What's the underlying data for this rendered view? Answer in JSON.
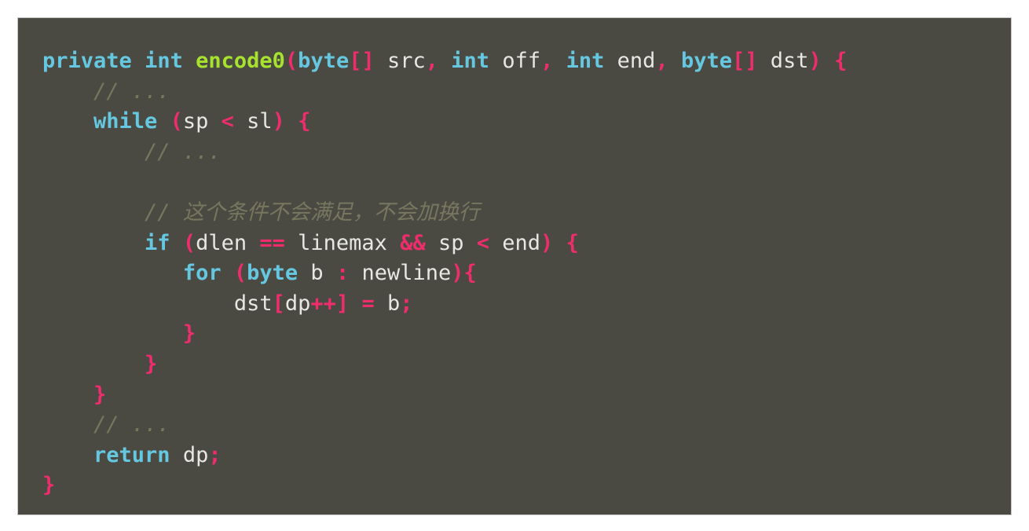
{
  "window": {
    "background_color": "#ffffff",
    "code_background_color": "#4a4a42",
    "border_color": "#c9c9c9"
  },
  "theme": {
    "name": "monokai-like",
    "keyword_color": "#66c7e0",
    "type_color": "#66c7e0",
    "method_color": "#a6e22e",
    "punctuation_color": "#ef2d6d",
    "operator_color": "#ef2d6d",
    "plain_color": "#e8e8e3",
    "comment_color": "#77775f"
  },
  "code": {
    "language": "java",
    "plain_text": "private int encode0(byte[] src, int off, int end, byte[] dst) {\n    // ...\n    while (sp < sl) {\n        // ...\n\n        // 这个条件不会满足，不会加换行\n        if (dlen == linemax && sp < end) {\n           for (byte b : newline){\n               dst[dp++] = b;\n           }\n        }\n    }\n    // ...\n    return dp;\n}",
    "lines": [
      {
        "index": 1,
        "tokens": [
          {
            "text": "private",
            "kind": "keyword"
          },
          {
            "text": " ",
            "kind": "space"
          },
          {
            "text": "int",
            "kind": "keyword"
          },
          {
            "text": " ",
            "kind": "space"
          },
          {
            "text": "encode0",
            "kind": "method"
          },
          {
            "text": "(",
            "kind": "punct"
          },
          {
            "text": "byte",
            "kind": "type"
          },
          {
            "text": "[]",
            "kind": "punct"
          },
          {
            "text": " src",
            "kind": "plain"
          },
          {
            "text": ",",
            "kind": "punct"
          },
          {
            "text": " ",
            "kind": "space"
          },
          {
            "text": "int",
            "kind": "type"
          },
          {
            "text": " off",
            "kind": "plain"
          },
          {
            "text": ",",
            "kind": "punct"
          },
          {
            "text": " ",
            "kind": "space"
          },
          {
            "text": "int",
            "kind": "type"
          },
          {
            "text": " end",
            "kind": "plain"
          },
          {
            "text": ",",
            "kind": "punct"
          },
          {
            "text": " ",
            "kind": "space"
          },
          {
            "text": "byte",
            "kind": "type"
          },
          {
            "text": "[]",
            "kind": "punct"
          },
          {
            "text": " dst",
            "kind": "plain"
          },
          {
            "text": ")",
            "kind": "punct"
          },
          {
            "text": " ",
            "kind": "space"
          },
          {
            "text": "{",
            "kind": "punct"
          }
        ]
      },
      {
        "index": 2,
        "tokens": [
          {
            "text": "    ",
            "kind": "space"
          },
          {
            "text": "// ...",
            "kind": "comment"
          }
        ]
      },
      {
        "index": 3,
        "tokens": [
          {
            "text": "    ",
            "kind": "space"
          },
          {
            "text": "while",
            "kind": "keyword"
          },
          {
            "text": " ",
            "kind": "space"
          },
          {
            "text": "(",
            "kind": "punct"
          },
          {
            "text": "sp ",
            "kind": "plain"
          },
          {
            "text": "<",
            "kind": "operator"
          },
          {
            "text": " sl",
            "kind": "plain"
          },
          {
            "text": ")",
            "kind": "punct"
          },
          {
            "text": " ",
            "kind": "space"
          },
          {
            "text": "{",
            "kind": "punct"
          }
        ]
      },
      {
        "index": 4,
        "tokens": [
          {
            "text": "        ",
            "kind": "space"
          },
          {
            "text": "// ...",
            "kind": "comment"
          }
        ]
      },
      {
        "index": 5,
        "tokens": [
          {
            "text": "",
            "kind": "space"
          }
        ]
      },
      {
        "index": 6,
        "tokens": [
          {
            "text": "        ",
            "kind": "space"
          },
          {
            "text": "// 这个条件不会满足，不会加换行",
            "kind": "comment"
          }
        ]
      },
      {
        "index": 7,
        "tokens": [
          {
            "text": "        ",
            "kind": "space"
          },
          {
            "text": "if",
            "kind": "keyword"
          },
          {
            "text": " ",
            "kind": "space"
          },
          {
            "text": "(",
            "kind": "punct"
          },
          {
            "text": "dlen ",
            "kind": "plain"
          },
          {
            "text": "==",
            "kind": "operator"
          },
          {
            "text": " linemax ",
            "kind": "plain"
          },
          {
            "text": "&&",
            "kind": "operator"
          },
          {
            "text": " sp ",
            "kind": "plain"
          },
          {
            "text": "<",
            "kind": "operator"
          },
          {
            "text": " end",
            "kind": "plain"
          },
          {
            "text": ")",
            "kind": "punct"
          },
          {
            "text": " ",
            "kind": "space"
          },
          {
            "text": "{",
            "kind": "punct"
          }
        ]
      },
      {
        "index": 8,
        "tokens": [
          {
            "text": "           ",
            "kind": "space"
          },
          {
            "text": "for",
            "kind": "keyword"
          },
          {
            "text": " ",
            "kind": "space"
          },
          {
            "text": "(",
            "kind": "punct"
          },
          {
            "text": "byte",
            "kind": "type"
          },
          {
            "text": " b ",
            "kind": "plain"
          },
          {
            "text": ":",
            "kind": "punct"
          },
          {
            "text": " newline",
            "kind": "plain"
          },
          {
            "text": ")",
            "kind": "punct"
          },
          {
            "text": "{",
            "kind": "punct"
          }
        ]
      },
      {
        "index": 9,
        "tokens": [
          {
            "text": "               ",
            "kind": "space"
          },
          {
            "text": "dst",
            "kind": "plain"
          },
          {
            "text": "[",
            "kind": "punct"
          },
          {
            "text": "dp",
            "kind": "plain"
          },
          {
            "text": "++",
            "kind": "operator"
          },
          {
            "text": "]",
            "kind": "punct"
          },
          {
            "text": " ",
            "kind": "space"
          },
          {
            "text": "=",
            "kind": "operator"
          },
          {
            "text": " b",
            "kind": "plain"
          },
          {
            "text": ";",
            "kind": "punct"
          }
        ]
      },
      {
        "index": 10,
        "tokens": [
          {
            "text": "           ",
            "kind": "space"
          },
          {
            "text": "}",
            "kind": "punct"
          }
        ]
      },
      {
        "index": 11,
        "tokens": [
          {
            "text": "        ",
            "kind": "space"
          },
          {
            "text": "}",
            "kind": "punct"
          }
        ]
      },
      {
        "index": 12,
        "tokens": [
          {
            "text": "    ",
            "kind": "space"
          },
          {
            "text": "}",
            "kind": "punct"
          }
        ]
      },
      {
        "index": 13,
        "tokens": [
          {
            "text": "    ",
            "kind": "space"
          },
          {
            "text": "// ...",
            "kind": "comment"
          }
        ]
      },
      {
        "index": 14,
        "tokens": [
          {
            "text": "    ",
            "kind": "space"
          },
          {
            "text": "return",
            "kind": "keyword"
          },
          {
            "text": " dp",
            "kind": "plain"
          },
          {
            "text": ";",
            "kind": "punct"
          }
        ]
      },
      {
        "index": 15,
        "tokens": [
          {
            "text": "}",
            "kind": "punct"
          }
        ]
      }
    ]
  }
}
